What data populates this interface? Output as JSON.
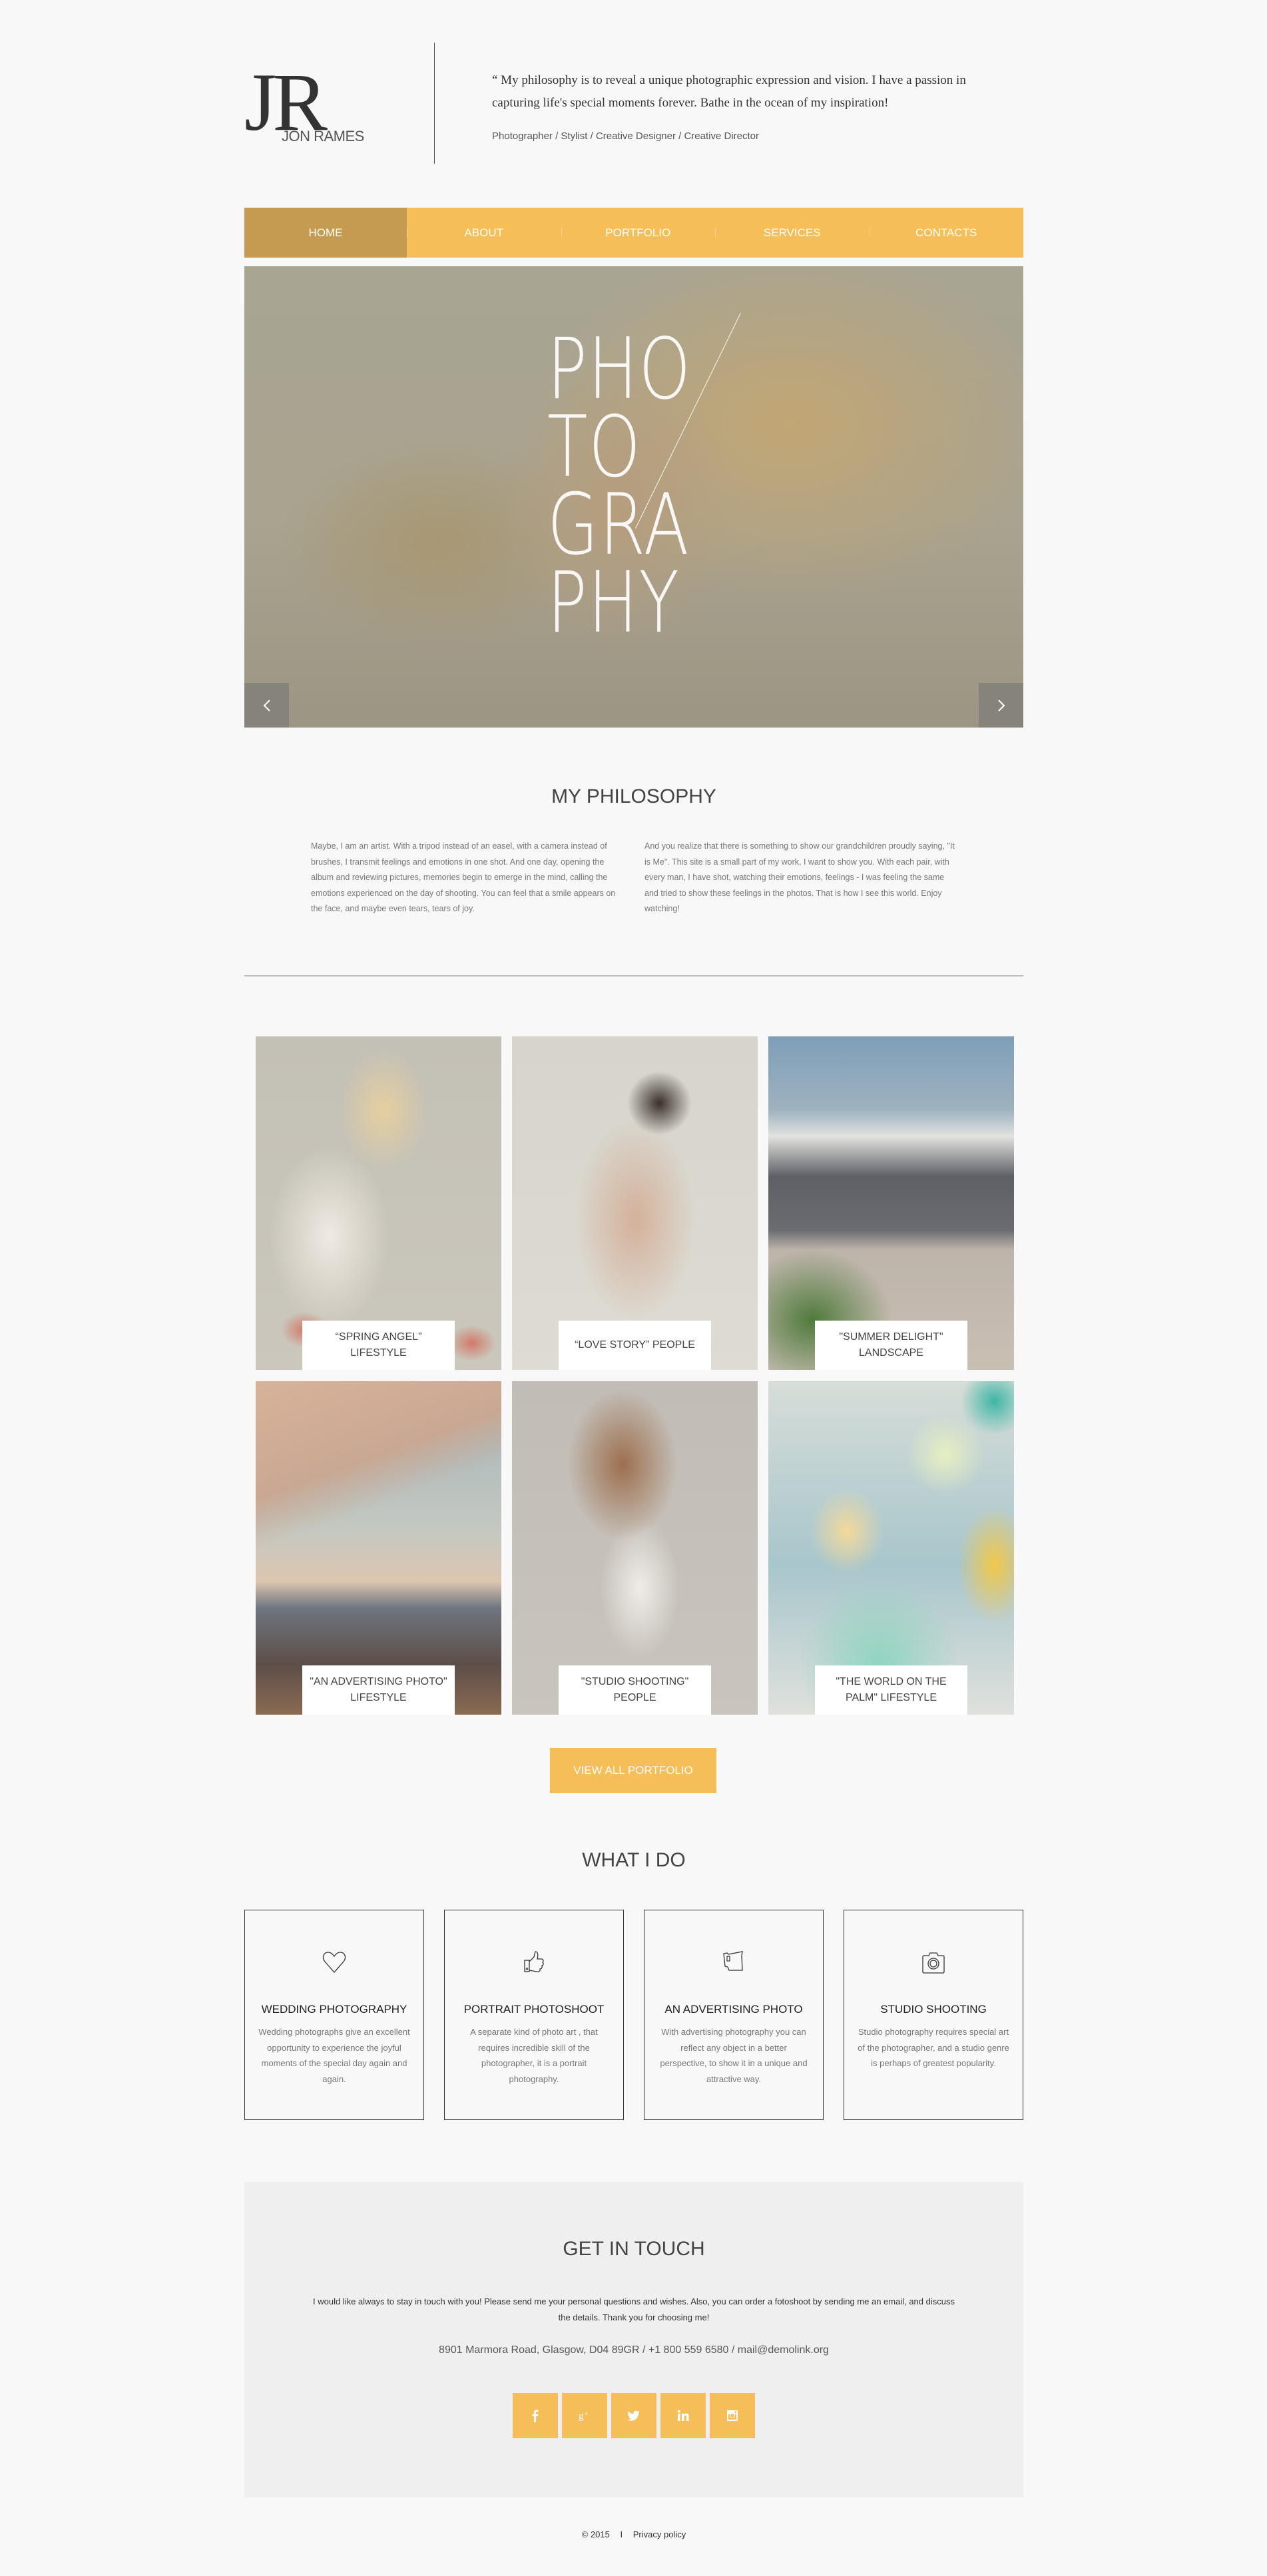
{
  "header": {
    "logo_monogram": "JR",
    "logo_name": "JON RAMES",
    "quote": "“ My philosophy is to reveal a unique photographic expression and vision. I have a passion in capturing life's special moments forever. Bathe in the ocean of my inspiration!",
    "roles": "Photographer / Stylist / Creative Designer / Creative Director"
  },
  "nav": {
    "items": [
      {
        "label": "HOME",
        "active": true
      },
      {
        "label": "ABOUT"
      },
      {
        "label": "PORTFOLIO"
      },
      {
        "label": "SERVICES"
      },
      {
        "label": "CONTACTS"
      }
    ],
    "colors": {
      "bar": "#f5be58",
      "active": "#c59b52"
    }
  },
  "hero": {
    "lines": [
      "PHO",
      "TO",
      "GRA",
      "PHY"
    ],
    "prev_icon": "chevron-left-icon",
    "next_icon": "chevron-right-icon"
  },
  "philosophy": {
    "title": "MY PHILOSOPHY",
    "col1": "Maybe, I am an artist. With a tripod instead of an easel, with a camera instead of brushes, I transmit feelings and emotions in one shot. And one day, opening the album and reviewing pictures, memories begin to emerge in the mind, calling the emotions experienced on the day of shooting. You can feel that a smile appears on the face, and maybe even tears, tears of joy.",
    "col2": "And you realize that there is something to show our grandchildren proudly saying, \"It is Me\". This site is a small part of my work, I want to show you. With each pair, with every man, I have shot, watching their emotions, feelings - I was feeling the same and tried to show these feelings in the photos. That is how I see this world. Enjoy watching!"
  },
  "portfolio": {
    "items": [
      {
        "caption": "“SPRING ANGEL” LIFESTYLE"
      },
      {
        "caption": "“LOVE STORY” PEOPLE"
      },
      {
        "caption": "\"SUMMER DELIGHT\" LANDSCAPE"
      },
      {
        "caption": "\"AN ADVERTISING PHOTO\" LIFESTYLE"
      },
      {
        "caption": "\"STUDIO SHOOTING\" PEOPLE"
      },
      {
        "caption": "\"THE WORLD ON THE PALM\" LIFESTYLE"
      }
    ],
    "button_label": "VIEW ALL PORTFOLIO"
  },
  "services": {
    "title": "WHAT I DO",
    "items": [
      {
        "icon": "heart-icon",
        "title": "WEDDING PHOTOGRAPHY",
        "desc": "Wedding photographs give an excellent opportunity to experience the joyful moments of the special day again and again."
      },
      {
        "icon": "thumbs-up-icon",
        "title": "PORTRAIT PHOTOSHOOT",
        "desc": "A separate kind of photo art , that requires incredible skill of the photographer, it is a portrait photography."
      },
      {
        "icon": "mug-icon",
        "title": "AN ADVERTISING PHOTO",
        "desc": "With advertising photography you can reflect any object in a better perspective, to show it in a unique and attractive way."
      },
      {
        "icon": "camera-icon",
        "title": "STUDIO SHOOTING",
        "desc": "Studio photography requires special art of the photographer, and a studio genre is perhaps of greatest popularity."
      }
    ]
  },
  "contact": {
    "title": "GET IN TOUCH",
    "text": "I would like always to stay in touch with you! Please send me your personal questions and wishes. Also, you can order a fotoshoot by sending me an email, and discuss the details. Thank you for choosing me!",
    "info": "8901 Marmora Road, Glasgow, D04 89GR  /  +1 800 559 6580  /  mail@demolink.org",
    "social": [
      "facebook-icon",
      "google-plus-icon",
      "twitter-icon",
      "linkedin-icon",
      "instagram-icon"
    ]
  },
  "footer": {
    "copyright": "© 2015",
    "separator": "I",
    "privacy": "Privacy policy"
  }
}
